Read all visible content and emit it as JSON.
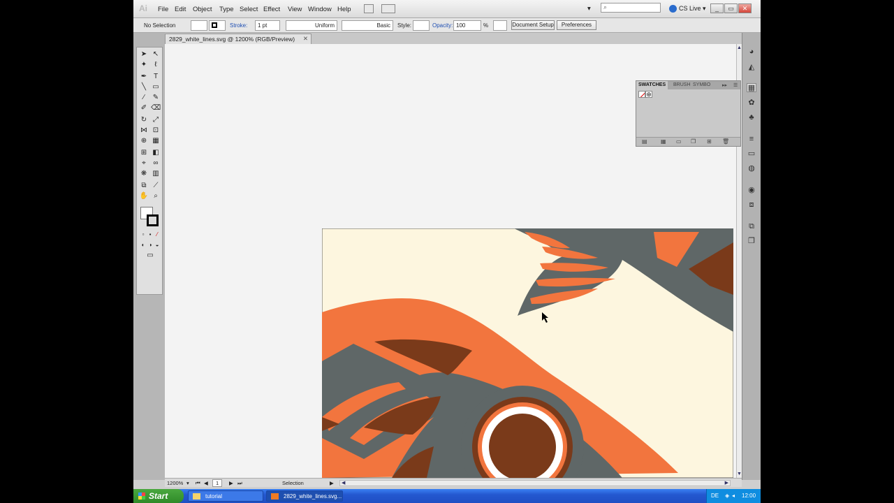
{
  "menubar": {
    "logo": "Ai",
    "items": [
      "File",
      "Edit",
      "Object",
      "Type",
      "Select",
      "Effect",
      "View",
      "Window",
      "Help"
    ],
    "cslive": "CS Live"
  },
  "control": {
    "selection": "No Selection",
    "stroke_label": "Stroke:",
    "stroke_weight": "1 pt",
    "profile": "Uniform",
    "brush": "Basic",
    "style_label": "Style:",
    "opacity_label": "Opacity:",
    "opacity_value": "100",
    "percent": "%",
    "doc_setup": "Document Setup",
    "preferences": "Preferences"
  },
  "document": {
    "tab_title": "2829_white_lines.svg @ 1200% (RGB/Preview)"
  },
  "status": {
    "zoom": "1200%",
    "page": "1",
    "tool": "Selection"
  },
  "swatches": {
    "tabs": [
      "SWATCHES",
      "BRUSH",
      "SYMBO"
    ]
  },
  "art_colors": {
    "background": "#fdf6df",
    "orange": "#f2753e",
    "gray": "#5f6767",
    "brown": "#7a3a1a",
    "white": "#ffffff"
  },
  "taskbar": {
    "start": "Start",
    "tasks": [
      {
        "label": "tutorial"
      },
      {
        "label": "2829_white_lines.svg..."
      }
    ],
    "lang": "DE",
    "clock": "12:00"
  }
}
